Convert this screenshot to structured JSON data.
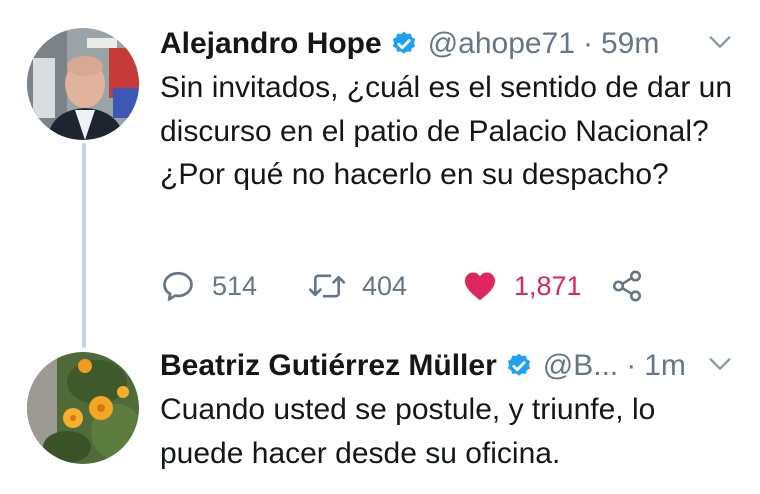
{
  "tweet1": {
    "author_name": "Alejandro Hope",
    "handle": "@ahope71",
    "separator": "·",
    "time": "59m",
    "text": "Sin invitados, ¿cuál es el sentido de dar un discurso en el patio de Palacio Nacional? ¿Por qué no hacerlo en su despacho?",
    "replies": "514",
    "retweets": "404",
    "likes": "1,871",
    "liked": true
  },
  "tweet2": {
    "author_name": "Beatriz Gutiérrez Müller",
    "handle": "@B...",
    "separator": "·",
    "time": "1m",
    "text": "Cuando usted se postule, y triunfe, lo puede hacer desde su oficina."
  },
  "colors": {
    "verified_blue": "#1da1f2",
    "like_red": "#e0245e",
    "muted_gray": "#657786",
    "thread_line": "#c7d4df"
  },
  "icons": [
    "verified-badge-icon",
    "chevron-down-icon",
    "reply-icon",
    "retweet-icon",
    "heart-icon",
    "share-icon"
  ]
}
